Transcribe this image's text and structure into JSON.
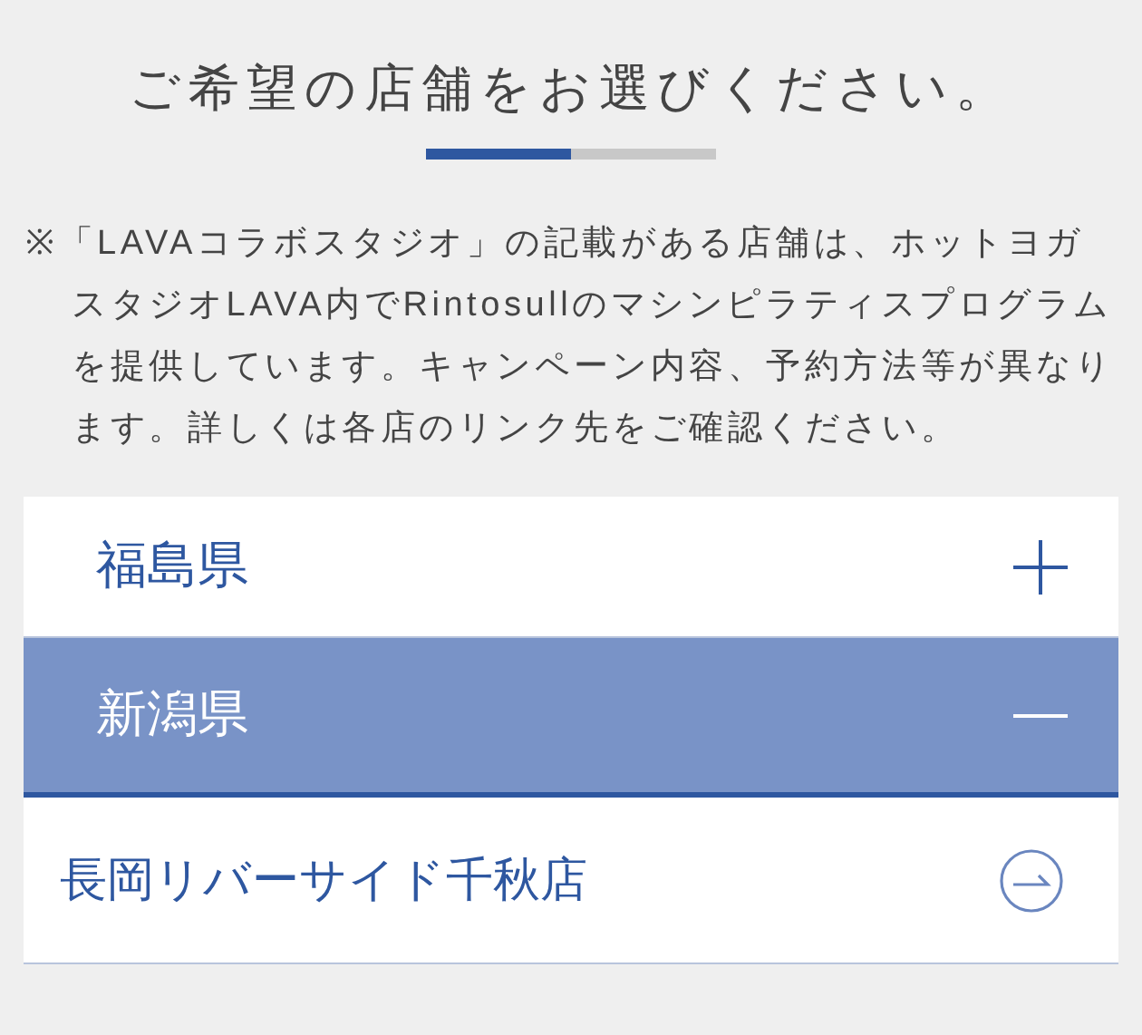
{
  "title": "ご希望の店舗をお選びください。",
  "progress": {
    "level": 0.5
  },
  "note": "※「LAVAコラボスタジオ」の記載がある店舗は、ホットヨガスタジオLAVA内でRintosullのマシンピラティスプログラムを提供しています。キャンペーン内容、予約方法等が異なります。詳しくは各店のリンク先をご確認ください。",
  "prefectures": [
    {
      "name": "福島県",
      "expanded": false
    },
    {
      "name": "新潟県",
      "expanded": true,
      "stores": [
        {
          "name": "長岡リバーサイド千秋店"
        }
      ]
    }
  ]
}
